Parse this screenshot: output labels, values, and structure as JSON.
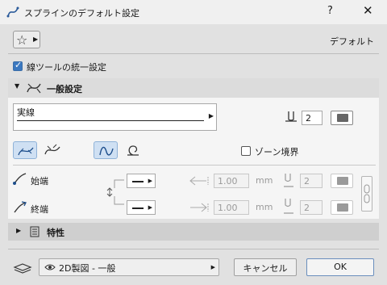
{
  "window": {
    "title": "スプラインのデフォルト設定",
    "help": "?",
    "close": "✕"
  },
  "favorites": {
    "label": "デフォルト"
  },
  "unify": {
    "label": "線ツールの統一設定"
  },
  "general": {
    "header": "一般設定",
    "line_type_name": "実線",
    "pen_number": "2",
    "zone_boundary_label": "ゾーン境界"
  },
  "ends": {
    "start_label": "始端",
    "end_label": "終端",
    "start_size": "1.00",
    "end_size": "1.00",
    "unit": "mm",
    "start_pen": "2",
    "end_pen": "2"
  },
  "properties": {
    "header": "特性"
  },
  "footer": {
    "layer": "2D製図 - 一般",
    "cancel_label": "キャンセル",
    "ok_label": "OK"
  }
}
